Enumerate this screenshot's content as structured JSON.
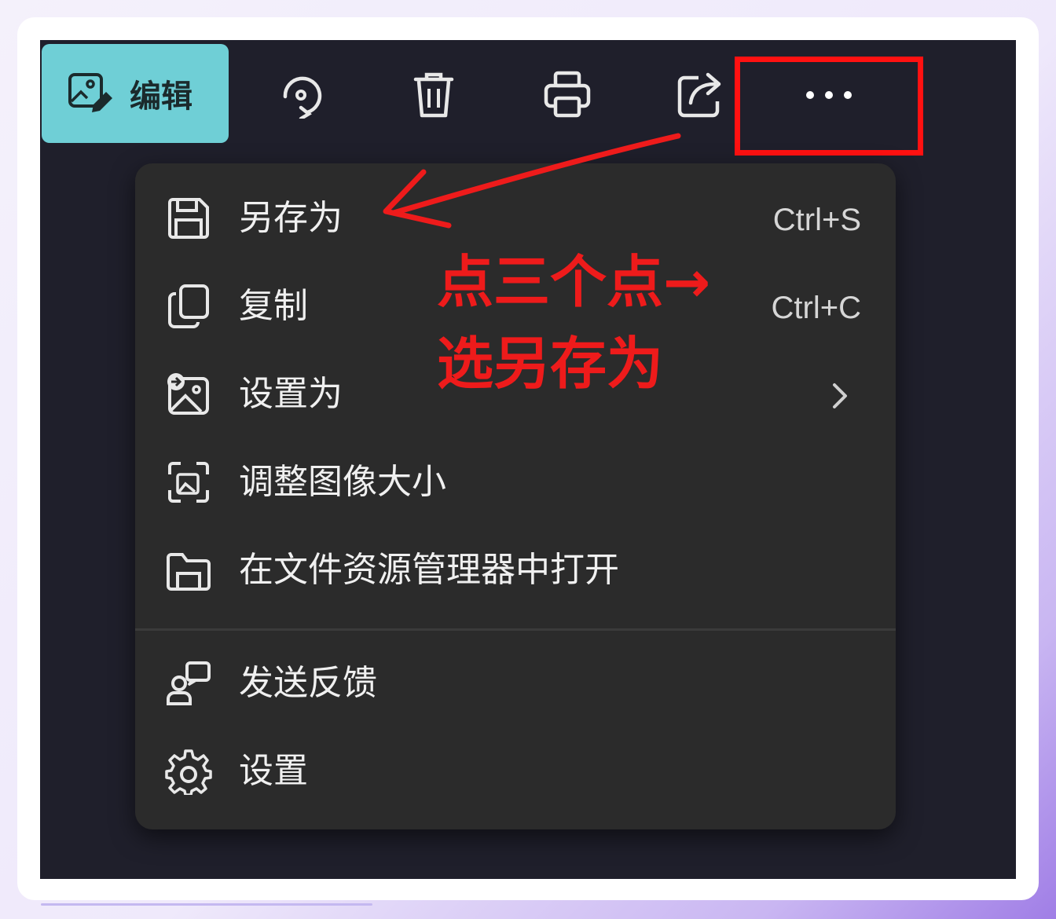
{
  "toolbar": {
    "edit_label": "编辑",
    "icons": [
      "edit-image-icon",
      "rotate-icon",
      "delete-icon",
      "print-icon",
      "share-icon",
      "more-icon"
    ]
  },
  "menu": {
    "items": [
      {
        "label": "另存为",
        "shortcut": "Ctrl+S",
        "icon": "save-icon"
      },
      {
        "label": "复制",
        "shortcut": "Ctrl+C",
        "icon": "copy-icon"
      },
      {
        "label": "设置为",
        "shortcut": "",
        "icon": "set-as-icon"
      },
      {
        "label": "调整图像大小",
        "shortcut": "",
        "icon": "resize-icon"
      },
      {
        "label": "在文件资源管理器中打开",
        "shortcut": "",
        "icon": "folder-icon"
      },
      {
        "label": "发送反馈",
        "shortcut": "",
        "icon": "feedback-icon"
      },
      {
        "label": "设置",
        "shortcut": "",
        "icon": "gear-icon"
      }
    ]
  },
  "annotation": {
    "line1": "点三个点→",
    "line2": "选另存为",
    "color": "#ee1b1b"
  },
  "colors": {
    "accent": "#6fcfd6",
    "menu_bg": "#2b2b2b",
    "screen_bg": "#1f1f2b",
    "highlight": "#ff1111"
  }
}
